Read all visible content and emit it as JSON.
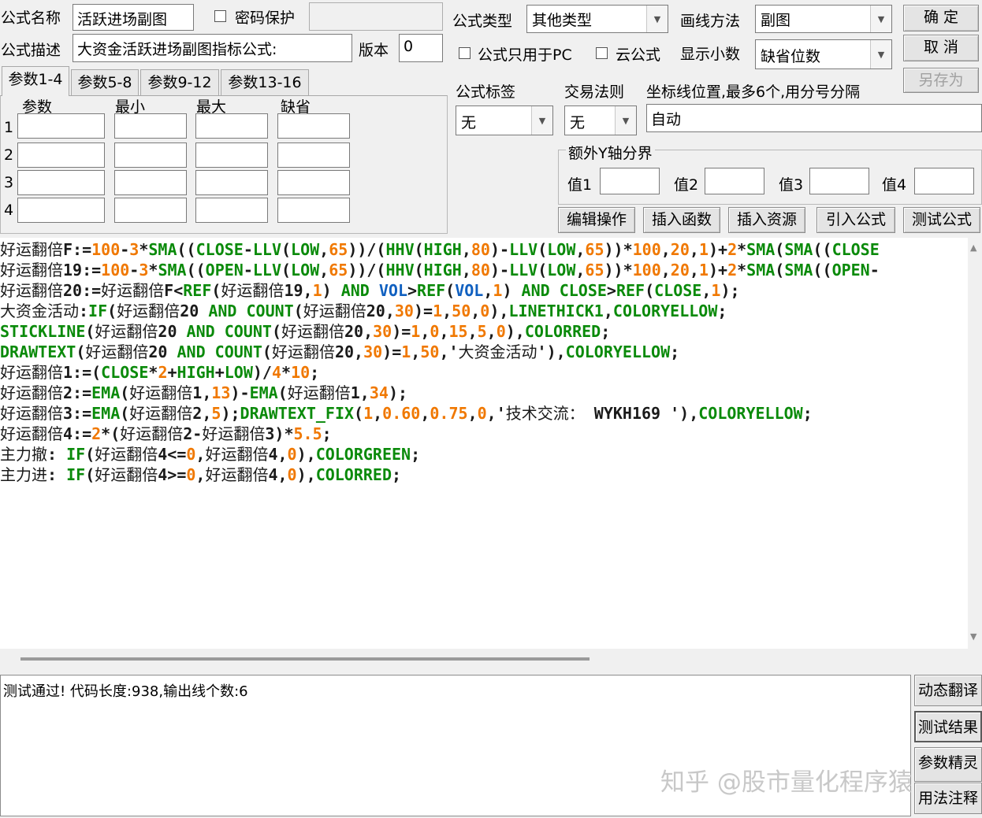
{
  "header": {
    "name_label": "公式名称",
    "name_value": "活跃进场副图",
    "password_label": "密码保护",
    "desc_label": "公式描述",
    "desc_value": "大资金活跃进场副图指标公式:",
    "version_label": "版本",
    "version_value": "0",
    "type_label": "公式类型",
    "type_value": "其他类型",
    "draw_label": "画线方法",
    "draw_value": "副图",
    "pc_only_label": "公式只用于PC",
    "cloud_label": "云公式",
    "decimal_label": "显示小数",
    "decimal_value": "缺省位数"
  },
  "buttons": {
    "ok": "确  定",
    "cancel": "取  消",
    "save_as": "另存为"
  },
  "tabs": [
    "参数1-4",
    "参数5-8",
    "参数9-12",
    "参数13-16"
  ],
  "params": {
    "headers": [
      "参数",
      "最小",
      "最大",
      "缺省"
    ],
    "rows": [
      "1",
      "2",
      "3",
      "4"
    ]
  },
  "tag": {
    "label": "公式标签",
    "value": "无"
  },
  "rule": {
    "label": "交易法则",
    "value": "无"
  },
  "axis": {
    "label": "坐标线位置,最多6个,用分号分隔",
    "value": "自动"
  },
  "extra_y": {
    "title": "额外Y轴分界",
    "labels": [
      "值1",
      "值2",
      "值3",
      "值4"
    ]
  },
  "actions": [
    "编辑操作",
    "插入函数",
    "插入资源",
    "引入公式",
    "测试公式"
  ],
  "message": "测试通过! 代码长度:938,输出线个数:6",
  "side_buttons": [
    "动态翻译",
    "测试结果",
    "参数精灵",
    "用法注释"
  ],
  "watermark": "知乎 @股市量化程序猿"
}
